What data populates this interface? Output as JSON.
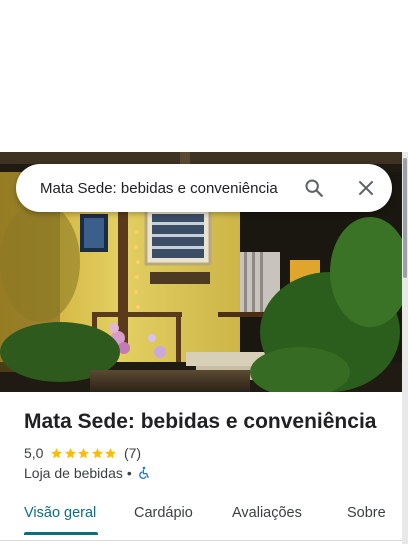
{
  "search": {
    "value": "Mata Sede: bebidas e conveniência",
    "search_icon": "search-icon",
    "close_icon": "close-icon"
  },
  "place": {
    "title": "Mata Sede: bebidas e conveniência",
    "rating": "5,0",
    "stars": 5,
    "reviews": "(7)",
    "category": "Loja de bebidas",
    "separator": "•",
    "accessibility_icon": "wheelchair-icon"
  },
  "tabs": [
    {
      "label": "Visão geral",
      "active": true
    },
    {
      "label": "Cardápio",
      "active": false
    },
    {
      "label": "Avaliações",
      "active": false
    },
    {
      "label": "Sobre",
      "active": false
    }
  ],
  "colors": {
    "accent": "#0b6e7d",
    "star": "#fbbc04",
    "accessibility": "#1a73e8"
  }
}
